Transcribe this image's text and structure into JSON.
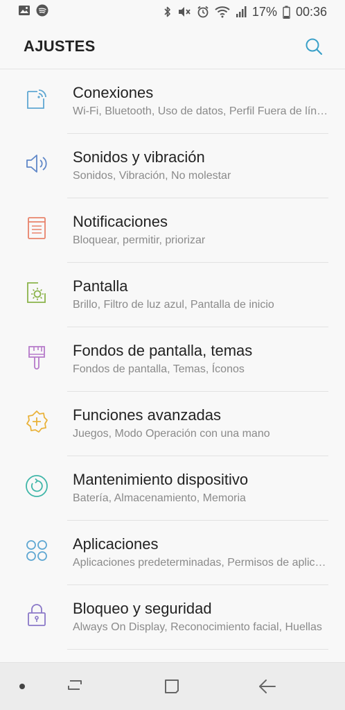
{
  "status_bar": {
    "battery_percent": "17%",
    "time": "00:36",
    "left_icons": [
      "gallery-icon",
      "spotify-icon"
    ],
    "right_icons": [
      "bluetooth-icon",
      "mute-icon",
      "alarm-icon",
      "wifi-icon",
      "signal-icon",
      "battery-icon"
    ]
  },
  "header": {
    "title": "AJUSTES",
    "search_icon": "search-icon"
  },
  "colors": {
    "connections": "#5fa7d2",
    "sounds": "#5f87c8",
    "notifications": "#e8836b",
    "display": "#8bb34a",
    "wallpapers": "#b67ac9",
    "advanced": "#e9b23a",
    "maintenance": "#3fb6a8",
    "apps": "#5fa7d2",
    "lock": "#8a78c8"
  },
  "settings": [
    {
      "title": "Conexiones",
      "subtitle": "Wi-Fi, Bluetooth, Uso de datos, Perfil Fuera de línea",
      "icon": "connections-icon"
    },
    {
      "title": "Sonidos y vibración",
      "subtitle": "Sonidos, Vibración, No molestar",
      "icon": "speaker-icon"
    },
    {
      "title": "Notificaciones",
      "subtitle": "Bloquear, permitir, priorizar",
      "icon": "notifications-icon"
    },
    {
      "title": "Pantalla",
      "subtitle": "Brillo, Filtro de luz azul, Pantalla de inicio",
      "icon": "display-icon"
    },
    {
      "title": "Fondos de pantalla, temas",
      "subtitle": "Fondos de pantalla, Temas, Íconos",
      "icon": "brush-icon"
    },
    {
      "title": "Funciones avanzadas",
      "subtitle": "Juegos, Modo Operación con una mano",
      "icon": "gear-plus-icon"
    },
    {
      "title": "Mantenimiento dispositivo",
      "subtitle": "Batería, Almacenamiento, Memoria",
      "icon": "maintenance-icon"
    },
    {
      "title": "Aplicaciones",
      "subtitle": "Aplicaciones predeterminadas, Permisos de aplicaciones",
      "icon": "apps-icon"
    },
    {
      "title": "Bloqueo y seguridad",
      "subtitle": "Always On Display, Reconocimiento facial, Huellas",
      "icon": "lock-icon"
    }
  ],
  "nav_bar": {
    "buttons": [
      "recents-icon",
      "home-icon",
      "back-icon"
    ]
  }
}
